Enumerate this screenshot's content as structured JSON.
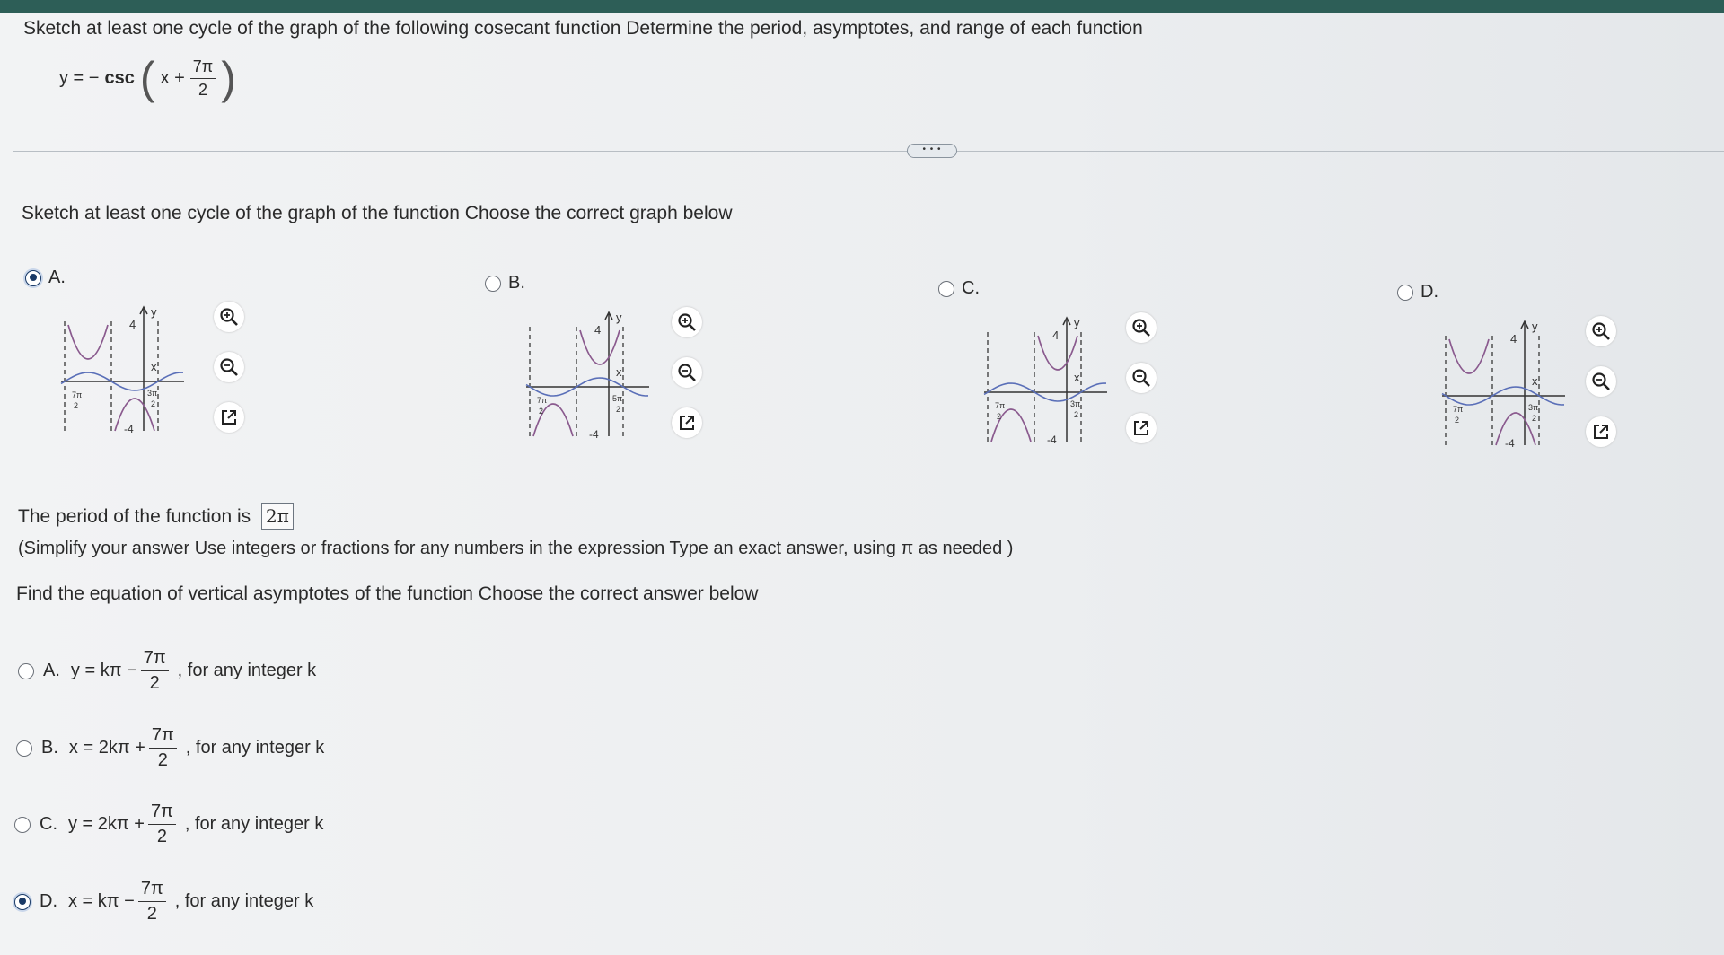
{
  "question": {
    "title": "Sketch at least one cycle of the graph of the following cosecant function Determine the period, asymptotes, and range of each function",
    "equation": {
      "lhs": "y = −",
      "func": "csc",
      "inner": "x +",
      "frac_num": "7π",
      "frac_den": "2"
    }
  },
  "expander_label": "• • •",
  "graph_section": {
    "title": "Sketch at least one cycle of the graph of the function Choose the correct graph below",
    "options": [
      {
        "letter": "A.",
        "selected": true,
        "y_tick": "4",
        "neg_tick": "-4",
        "x_label": "x",
        "y_label": "y",
        "left_label": "7π",
        "right_label": "3π"
      },
      {
        "letter": "B.",
        "selected": false,
        "y_tick": "4",
        "neg_tick": "-4",
        "x_label": "x",
        "y_label": "y",
        "left_label": "7π",
        "right_label": "5π"
      },
      {
        "letter": "C.",
        "selected": false,
        "y_tick": "4",
        "neg_tick": "-4",
        "x_label": "x",
        "y_label": "y",
        "left_label": "7π",
        "right_label": "3π"
      },
      {
        "letter": "D.",
        "selected": false,
        "y_tick": "4",
        "neg_tick": "-4",
        "x_label": "x",
        "y_label": "y",
        "left_label": "7π",
        "right_label": "3π"
      }
    ],
    "icons": [
      "zoom-in-icon",
      "zoom-out-icon",
      "popout-icon"
    ]
  },
  "period": {
    "label": "The period of the function is",
    "value": "2π"
  },
  "hint": "(Simplify your answer Use integers or fractions for any numbers in the expression Type an exact answer, using π as needed )",
  "asymptotes": {
    "title": "Find the equation of vertical asymptotes of the function Choose the correct answer below",
    "choices": [
      {
        "letter": "A.",
        "selected": false,
        "expr": "y = kπ −",
        "num": "7π",
        "den": "2",
        "tail": ", for any integer k"
      },
      {
        "letter": "B.",
        "selected": false,
        "expr": "x = 2kπ +",
        "num": "7π",
        "den": "2",
        "tail": ", for any integer k"
      },
      {
        "letter": "C.",
        "selected": false,
        "expr": "y = 2kπ +",
        "num": "7π",
        "den": "2",
        "tail": ", for any integer k"
      },
      {
        "letter": "D.",
        "selected": true,
        "expr": "x = kπ −",
        "num": "7π",
        "den": "2",
        "tail": ", for any integer k"
      }
    ]
  },
  "colors": {
    "curve_blue": "#5a6fb8",
    "curve_purple": "#8a5a8e",
    "selected": "#1a3a66",
    "topbar": "#2d5e57"
  }
}
